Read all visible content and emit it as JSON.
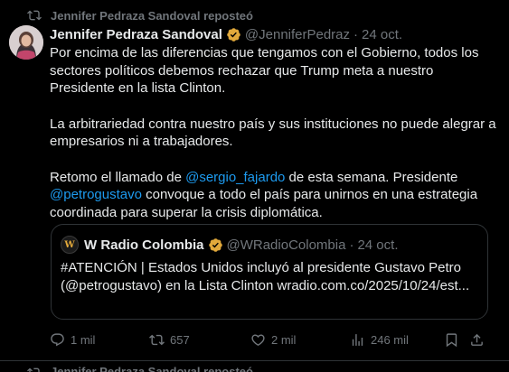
{
  "repost": {
    "text": "Jennifer Pedraza Sandoval reposteó"
  },
  "tweet": {
    "author_name": "Jennifer Pedraza Sandoval",
    "handle": "@JenniferPedraz",
    "separator": "·",
    "date": "24 oct.",
    "paragraph1": "Por encima de las diferencias que tengamos con el Gobierno, todos los sectores políticos debemos rechazar que Trump meta a nuestro Presidente en la lista Clinton.",
    "paragraph2": "La arbitrariedad contra nuestro país y sus instituciones no puede alegrar a empresarios ni a trabajadores.",
    "p3_before": "Retomo el llamado de ",
    "mention1": "@sergio_fajardo",
    "p3_middle": " de esta semana. Presidente ",
    "mention2": "@petrogustavo",
    "p3_after": " convoque a todo el país para unirnos en una estrategia coordinada para superar la crisis diplomática."
  },
  "quote": {
    "avatar_letter": "W",
    "author_name": "W Radio Colombia",
    "handle": "@WRadioColombia",
    "separator": "·",
    "date": "24 oct.",
    "text": "#ATENCIÓN | Estados Unidos incluyó al presidente Gustavo Petro (@petrogustavo) en la Lista Clinton wradio.com.co/2025/10/24/est..."
  },
  "actions": {
    "replies": "1 mil",
    "reposts": "657",
    "likes": "2 mil",
    "views": "246 mil"
  },
  "next_repost": {
    "text": "Jennifer Pedraza Sandoval reposteó"
  },
  "colors": {
    "background": "#000000",
    "text": "#e7e9ea",
    "muted": "#71767b",
    "link": "#1d9bf0",
    "border": "#2f3336",
    "verified_gold": "#e2a93b",
    "verified_blue": "#1d9bf0"
  },
  "icons": {
    "repost": "repost-icon",
    "reply": "reply-icon",
    "like": "heart-icon",
    "views": "views-chart-icon",
    "bookmark": "bookmark-icon",
    "verified": "verified-badge-icon"
  }
}
